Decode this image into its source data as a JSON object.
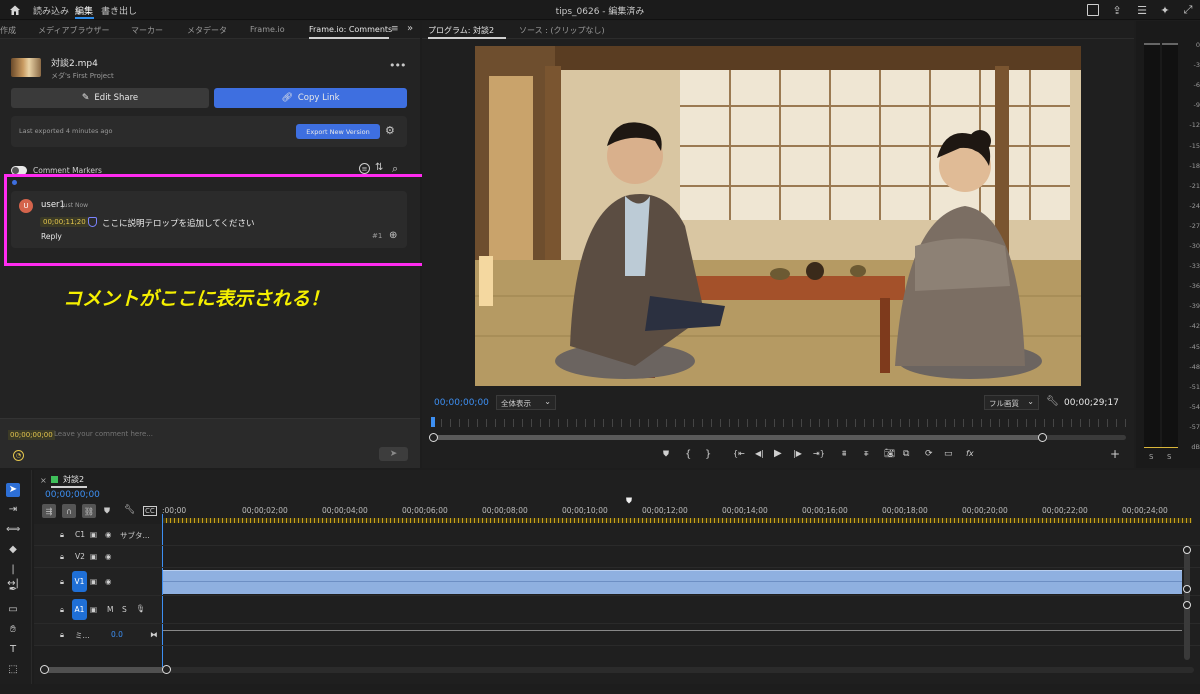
{
  "menubar": {
    "items": [
      "読み込み",
      "編集",
      "書き出し"
    ],
    "active_index": 1,
    "doc_title": "tips_0626 - 編集済み"
  },
  "left_panel": {
    "tabs": [
      "作成",
      "メディアブラウザー",
      "マーカー",
      "メタデータ",
      "Frame.io",
      "Frame.io: Comments"
    ],
    "active_tab": "Frame.io: Comments",
    "asset": {
      "filename": "対談2.mp4",
      "project": "メダ's First Project"
    },
    "edit_share_label": "Edit Share",
    "copy_link_label": "Copy Link",
    "last_exported": "Last exported 4 minutes ago",
    "export_button": "Export New Version",
    "comment_markers_label": "Comment Markers",
    "comment": {
      "avatar_letter": "U",
      "user": "user1",
      "time": "Just Now",
      "timecode": "00;00;11;20",
      "text": "ここに説明テロップを追加してください",
      "reply_label": "Reply",
      "number": "#1"
    },
    "annotation": "コメントがここに表示される！",
    "comment_input": {
      "timecode": "00;00;00;00",
      "placeholder": "Leave your comment here..."
    }
  },
  "monitor": {
    "tabs": [
      "プログラム: 対談2",
      "ソース : (クリップなし)"
    ],
    "timecode_in": "00;00;00;00",
    "zoom_select": "全体表示",
    "quality_select": "フル画質",
    "duration": "00;00;29;17"
  },
  "meters": {
    "scale": [
      "0",
      "-3",
      "-6",
      "-9",
      "-12",
      "-15",
      "-18",
      "-21",
      "-24",
      "-27",
      "-30",
      "-33",
      "-36",
      "-39",
      "-42",
      "-45",
      "-48",
      "-51",
      "-54",
      "-57",
      "dB"
    ],
    "solo_labels": [
      "S",
      "S"
    ]
  },
  "timeline": {
    "sequence_name": "対談2",
    "timecode": "00;00;00;00",
    "ruler": [
      ":00;00",
      "00;00;02;00",
      "00;00;04;00",
      "00;00;06;00",
      "00;00;08;00",
      "00;00;10;00",
      "00;00;12;00",
      "00;00;14;00",
      "00;00;16;00",
      "00;00;18;00",
      "00;00;20;00",
      "00;00;22;00",
      "00;00;24;00",
      "00"
    ],
    "tracks": {
      "c1": {
        "label": "C1",
        "name": "サブタ..."
      },
      "v2": {
        "label": "V2"
      },
      "v1": {
        "label": "V1"
      },
      "a1": {
        "label": "A1",
        "m": "M",
        "s": "S"
      },
      "mix": {
        "label": "ミ...",
        "value": "0.0"
      }
    }
  },
  "colors": {
    "accent": "#2d8ceb",
    "button_blue": "#3e6fe0",
    "highlight": "#ff2bf0",
    "annotation": "#f5f000",
    "clip": "#8fb0e0"
  }
}
